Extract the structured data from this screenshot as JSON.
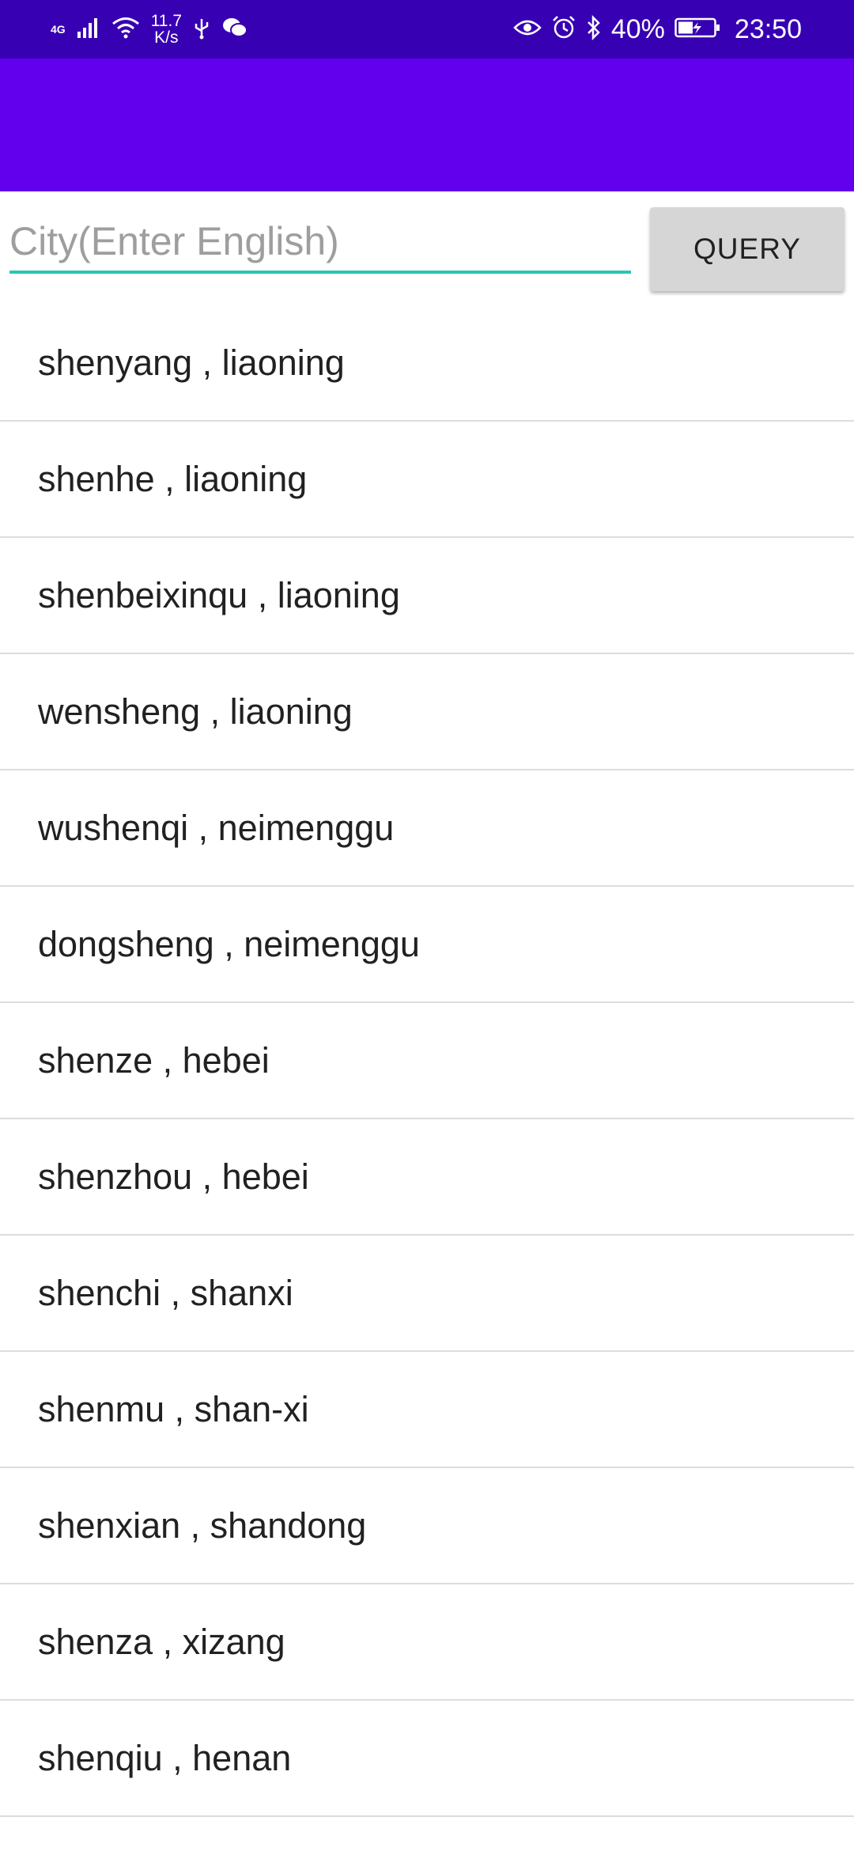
{
  "status_bar": {
    "network_type": "4G",
    "speed_value": "11.7",
    "speed_unit": "K/s",
    "battery_percent": "40%",
    "time": "23:50",
    "icons": [
      "signal-icon",
      "wifi-icon",
      "usb-icon",
      "wechat-icon",
      "eye-icon",
      "alarm-icon",
      "bluetooth-icon",
      "battery-charging-icon"
    ]
  },
  "search": {
    "placeholder": "City(Enter English)",
    "value": "",
    "button_label": "QUERY"
  },
  "results": [
    "shenyang , liaoning",
    "shenhe , liaoning",
    "shenbeixinqu , liaoning",
    "wensheng , liaoning",
    "wushenqi , neimenggu",
    "dongsheng , neimenggu",
    "shenze , hebei",
    "shenzhou , hebei",
    "shenchi , shanxi",
    "shenmu , shan-xi",
    "shenxian , shandong",
    "shenza , xizang",
    "shenqiu , henan"
  ],
  "colors": {
    "status_bar": "#3700b3",
    "app_bar": "#6200ee",
    "input_underline": "#26c6b9",
    "button_bg": "#d6d6d6"
  }
}
